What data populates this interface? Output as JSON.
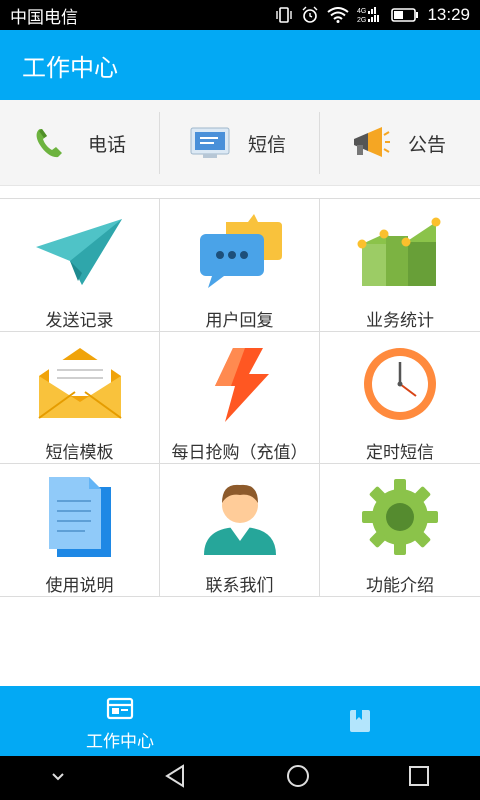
{
  "status_bar": {
    "carrier": "中国电信",
    "network": "4G 2G",
    "time": "13:29"
  },
  "header": {
    "title": "工作中心"
  },
  "quick_actions": [
    {
      "label": "电话",
      "icon": "phone-icon"
    },
    {
      "label": "短信",
      "icon": "sms-icon"
    },
    {
      "label": "公告",
      "icon": "announcement-icon"
    }
  ],
  "grid": [
    {
      "label": "发送记录",
      "icon": "paper-plane-icon"
    },
    {
      "label": "用户回复",
      "icon": "chat-bubbles-icon"
    },
    {
      "label": "业务统计",
      "icon": "statistics-chart-icon"
    },
    {
      "label": "短信模板",
      "icon": "envelope-icon"
    },
    {
      "label": "每日抢购（充值）",
      "icon": "lightning-icon"
    },
    {
      "label": "定时短信",
      "icon": "clock-icon"
    },
    {
      "label": "使用说明",
      "icon": "document-icon"
    },
    {
      "label": "联系我们",
      "icon": "person-icon"
    },
    {
      "label": "功能介绍",
      "icon": "gear-icon"
    }
  ],
  "bottom_nav": [
    {
      "label": "工作中心",
      "icon": "workbench-icon"
    },
    {
      "label": "",
      "icon": "book-icon"
    }
  ],
  "colors": {
    "primary": "#03a9f4"
  }
}
